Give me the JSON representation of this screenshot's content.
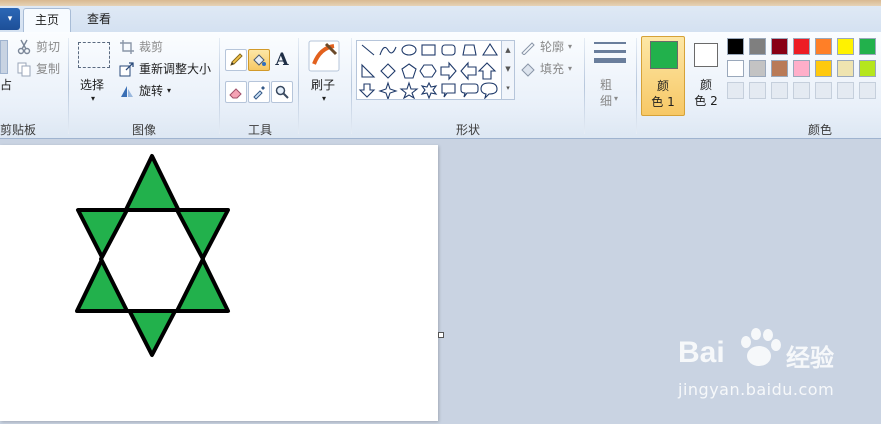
{
  "tabs": {
    "file_label": "▾",
    "home": "主页",
    "view": "查看"
  },
  "clipboard": {
    "paste_partial": "占",
    "cut": "剪切",
    "copy": "复制",
    "label": "剪贴板"
  },
  "image": {
    "select": "选择",
    "crop": "裁剪",
    "resize": "重新调整大小",
    "rotate": "旋转",
    "label": "图像"
  },
  "tools": {
    "label": "工具",
    "text_tool": "A"
  },
  "brush": {
    "label": "刷子"
  },
  "shapes": {
    "outline": "轮廓",
    "fill": "填充",
    "label": "形状"
  },
  "size": {
    "line1": "粗",
    "line2": "细"
  },
  "colors": {
    "color1_line1": "颜",
    "color1_line2": "色 1",
    "color2_line1": "颜",
    "color2_line2": "色 2",
    "label": "颜色",
    "color1": "#22b14c",
    "color2": "#ffffff",
    "palette_row1": [
      "#000000",
      "#7f7f7f",
      "#880015",
      "#ed1c24",
      "#ff7f27",
      "#fff200",
      "#22b14c"
    ],
    "palette_row2": [
      "#ffffff",
      "#c3c3c3",
      "#b97a57",
      "#ffaec9",
      "#ffc90e",
      "#efe4b0",
      "#b5e61d"
    ]
  },
  "canvas_drawing": {
    "fill": "#22b14c",
    "stroke": "#000000"
  },
  "watermark": {
    "brand": "Bai",
    "brand_cn": "经验",
    "url": "jingyan.baidu.com"
  }
}
